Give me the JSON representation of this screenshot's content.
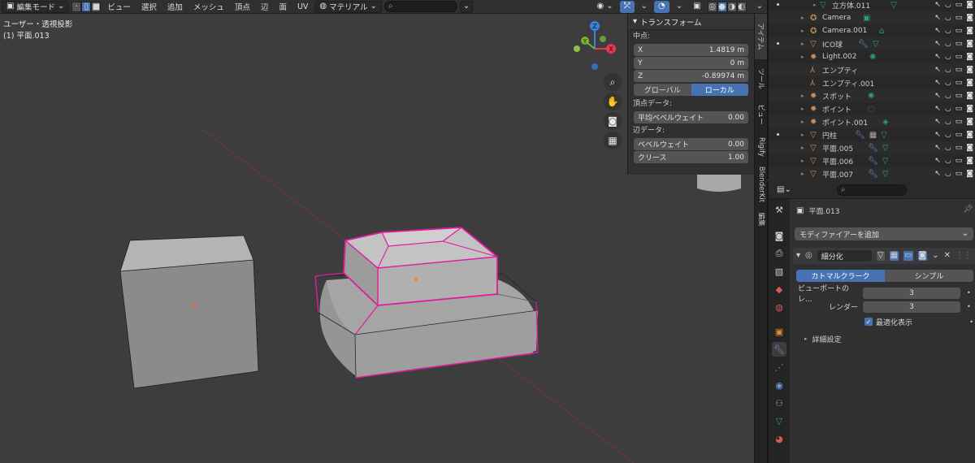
{
  "header": {
    "mode_label": "編集モード",
    "menus": [
      "ビュー",
      "選択",
      "追加",
      "メッシュ",
      "頂点",
      "辺",
      "面",
      "UV"
    ],
    "orientation_label": "マテリアル",
    "search_placeholder": ""
  },
  "viewport": {
    "view_name": "ユーザー・透視投影",
    "object_name": "(1) 平面.013",
    "gizmo": {
      "x": "X",
      "y": "Y",
      "z": "Z"
    }
  },
  "npanel": {
    "title": "トランスフォーム",
    "section_median": "中点:",
    "fields": [
      {
        "label": "X",
        "value": "1.4819 m"
      },
      {
        "label": "Y",
        "value": "0 m"
      },
      {
        "label": "Z",
        "value": "-0.89974 m"
      }
    ],
    "toggle": [
      "グローバル",
      "ローカル"
    ],
    "section_vertex": "頂点データ:",
    "vertex_field": {
      "label": "平均ベベルウェイト",
      "value": "0.00"
    },
    "section_edge": "辺データ:",
    "edge_fields": [
      {
        "label": "ベベルウェイト",
        "value": "0.00"
      },
      {
        "label": "クリース",
        "value": "1.00"
      }
    ],
    "tabs": [
      "アイテム",
      "ツール",
      "ビュー",
      "Rigify",
      "BlenderKit",
      "編集"
    ]
  },
  "outliner": {
    "rows": [
      {
        "name": "立方体.011",
        "icon": "mesh-icon",
        "color": "#2d9e73"
      },
      {
        "name": "Camera",
        "icon": "camera-icon",
        "color": "#c68a5a"
      },
      {
        "name": "Camera.001",
        "icon": "camera-icon",
        "color": "#c68a5a"
      },
      {
        "name": "ICO球",
        "icon": "mesh-icon",
        "color": "#c68a5a"
      },
      {
        "name": "Light.002",
        "icon": "light-icon",
        "color": "#c68a5a"
      },
      {
        "name": "エンプティ",
        "icon": "empty-icon",
        "color": "#c68a5a"
      },
      {
        "name": "エンプティ.001",
        "icon": "empty-icon",
        "color": "#c68a5a"
      },
      {
        "name": "スポット",
        "icon": "light-icon",
        "color": "#c68a5a"
      },
      {
        "name": "ポイント",
        "icon": "light-icon",
        "color": "#c68a5a"
      },
      {
        "name": "ポイント.001",
        "icon": "light-icon",
        "color": "#c68a5a"
      },
      {
        "name": "円柱",
        "icon": "mesh-icon",
        "color": "#c68a5a"
      },
      {
        "name": "平面.005",
        "icon": "mesh-icon",
        "color": "#c68a5a"
      },
      {
        "name": "平面.006",
        "icon": "mesh-icon",
        "color": "#c68a5a"
      },
      {
        "name": "平面.007",
        "icon": "mesh-icon",
        "color": "#c68a5a"
      }
    ]
  },
  "properties": {
    "object_name": "平面.013",
    "add_modifier": "モディファイアーを追加",
    "modifier_name": "細分化",
    "algo": [
      "カトマルクラーク",
      "シンプル"
    ],
    "viewport_label": "ビューポートのレ...",
    "viewport_value": "3",
    "render_label": "レンダー",
    "render_value": "3",
    "optimal_display": "最適化表示",
    "advanced": "詳細設定"
  },
  "colors": {
    "accent": "#4772b3",
    "selection_edge": "#e01ba0",
    "axis_x": "#e43c4c",
    "axis_y": "#74b52e",
    "axis_z": "#3b82d8"
  }
}
